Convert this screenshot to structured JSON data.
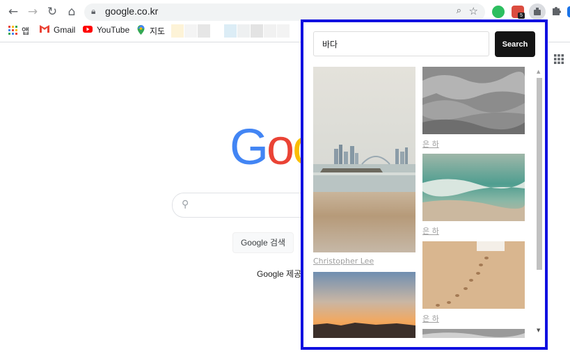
{
  "browser": {
    "url": "google.co.kr",
    "extension_badge": "5",
    "bookmarks": [
      {
        "label": "앱"
      },
      {
        "label": "Gmail"
      },
      {
        "label": "YouTube"
      },
      {
        "label": "지도"
      }
    ]
  },
  "google": {
    "logo_text": "Goo",
    "search_button": "Google 검색",
    "offered_in": "Google 제공 서비스"
  },
  "popup": {
    "search_value": "바다",
    "search_button": "Search",
    "photos": [
      {
        "credit": "Christopher Lee",
        "subject": "city skyline across sea with sandy beach"
      },
      {
        "credit": "",
        "subject": "sunset over coastline"
      },
      {
        "credit": "은 하",
        "subject": "grayscale waves on shore"
      },
      {
        "credit": "은 하",
        "subject": "turquoise ocean waves on sand"
      },
      {
        "credit": "은 하",
        "subject": "footprints in beach sand"
      },
      {
        "credit": "",
        "subject": "grayscale wave (partially visible)"
      }
    ]
  },
  "colors": {
    "popup_border": "#1010e0",
    "search_button_bg": "#141414",
    "credit_text": "#9e9e9e"
  }
}
